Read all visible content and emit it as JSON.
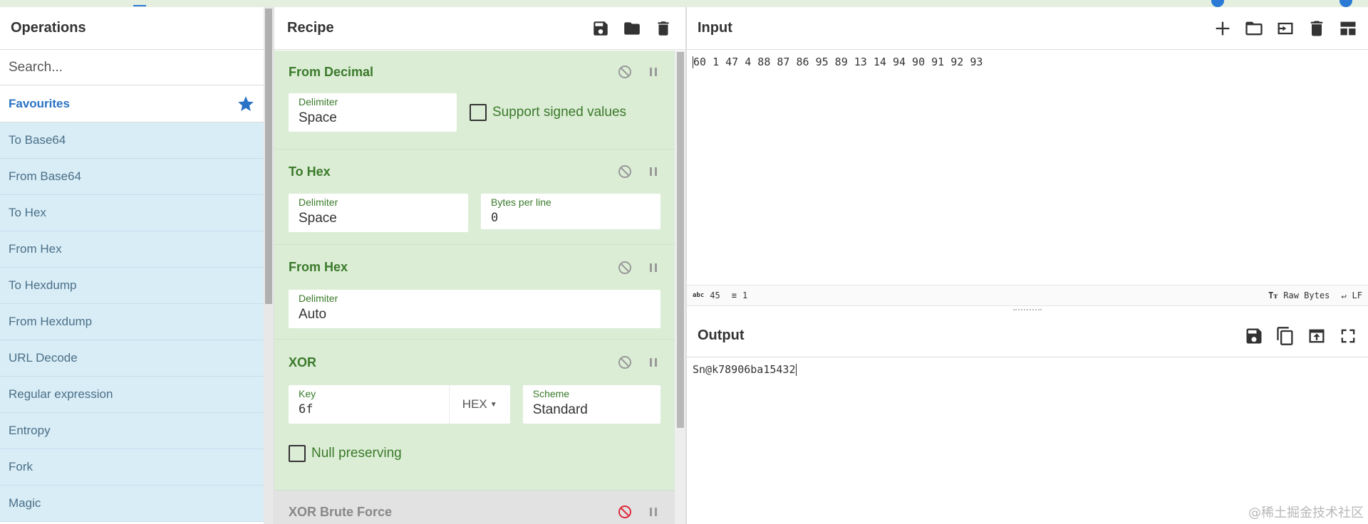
{
  "operations": {
    "title": "Operations",
    "search_placeholder": "Search...",
    "favourites_label": "Favourites",
    "items": [
      "To Base64",
      "From Base64",
      "To Hex",
      "From Hex",
      "To Hexdump",
      "From Hexdump",
      "URL Decode",
      "Regular expression",
      "Entropy",
      "Fork",
      "Magic"
    ]
  },
  "recipe": {
    "title": "Recipe",
    "ops": {
      "from_decimal": {
        "title": "From Decimal",
        "delimiter_label": "Delimiter",
        "delimiter_value": "Space",
        "signed_label": "Support signed values"
      },
      "to_hex": {
        "title": "To Hex",
        "delimiter_label": "Delimiter",
        "delimiter_value": "Space",
        "bpl_label": "Bytes per line",
        "bpl_value": "0"
      },
      "from_hex": {
        "title": "From Hex",
        "delimiter_label": "Delimiter",
        "delimiter_value": "Auto"
      },
      "xor": {
        "title": "XOR",
        "key_label": "Key",
        "key_value": "6f",
        "key_format": "HEX",
        "scheme_label": "Scheme",
        "scheme_value": "Standard",
        "null_label": "Null preserving"
      },
      "xor_brute": {
        "title": "XOR Brute Force"
      }
    }
  },
  "input": {
    "title": "Input",
    "text": "60 1 47 4 88 87 86 95 89 13 14 94 90 91 92 93",
    "status": {
      "length": "45",
      "lines": "1",
      "encoding": "Raw Bytes",
      "eol": "LF"
    }
  },
  "output": {
    "title": "Output",
    "text": "Sn@k78906ba15432"
  },
  "watermark": "@稀土掘金技术社区",
  "colors": {
    "accent": "#2a72c4",
    "op_bg": "#dcedd6",
    "op_text": "#3a7a2a",
    "fav_bg": "#d9edf7"
  }
}
